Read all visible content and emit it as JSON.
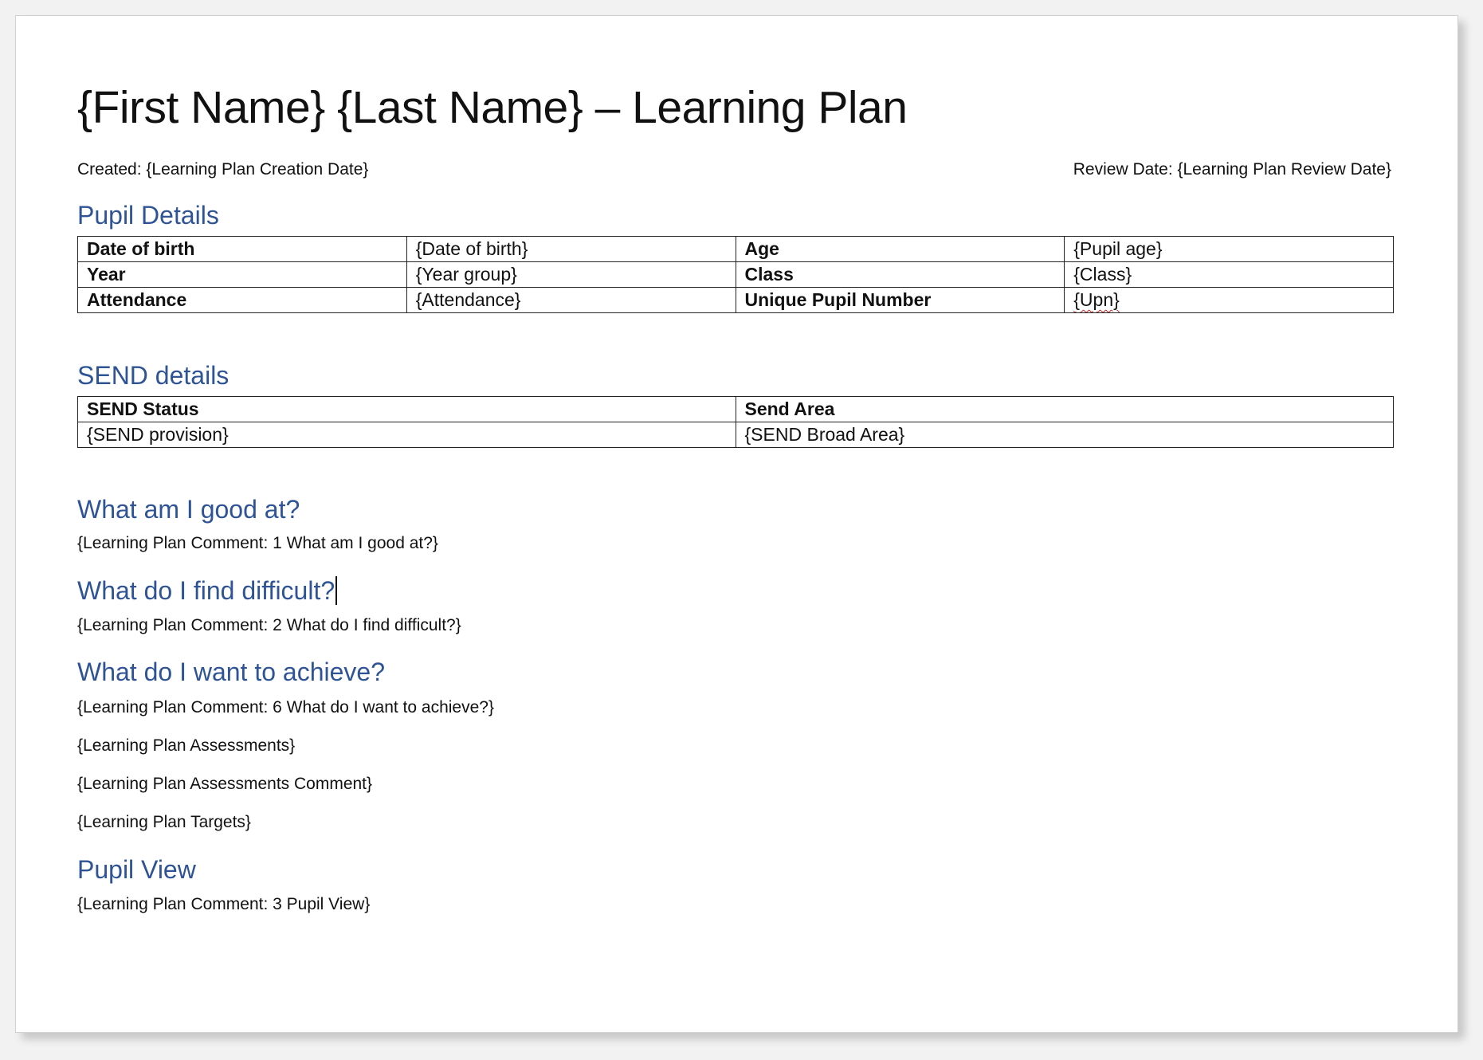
{
  "document": {
    "title": "{First Name} {Last Name} – Learning Plan",
    "created": "Created: {Learning Plan Creation Date}",
    "review_date": "Review Date: {Learning Plan Review Date}"
  },
  "pupil_details": {
    "heading": "Pupil Details",
    "rows": [
      [
        {
          "text": "Date of birth"
        },
        {
          "text": "{Date of birth}"
        },
        {
          "text": "Age"
        },
        {
          "text": "{Pupil age}"
        }
      ],
      [
        {
          "text": "Year"
        },
        {
          "text": "{Year group}"
        },
        {
          "text": "Class"
        },
        {
          "text": "{Class}"
        }
      ],
      [
        {
          "text": "Attendance"
        },
        {
          "text": "{Attendance}"
        },
        {
          "text": "Unique Pupil Number"
        },
        {
          "text": "{Upn}"
        }
      ]
    ]
  },
  "send_details": {
    "heading": "SEND details",
    "header": [
      "SEND Status",
      "Send Area"
    ],
    "values": [
      "{SEND provision}",
      "{SEND Broad Area}"
    ]
  },
  "sections": {
    "good_at": {
      "heading": "What am I good at?",
      "comment": "{Learning Plan Comment: 1 What am I good at?}"
    },
    "difficult": {
      "heading": "What do I find difficult?",
      "comment": "{Learning Plan Comment: 2 What do I find difficult?}"
    },
    "achieve": {
      "heading": "What do I want to achieve?",
      "comment": "{Learning Plan Comment: 6 What do I want to achieve?}",
      "assessments": "{Learning Plan Assessments}",
      "assessments_comment": "{Learning Plan Assessments Comment}",
      "targets": "{Learning Plan Targets}"
    },
    "pupil_view": {
      "heading": "Pupil View",
      "comment": "{Learning Plan Comment: 3 Pupil View}"
    }
  },
  "colors": {
    "heading": "#2f5496",
    "text": "#111111",
    "spellcheck": "#d02020"
  }
}
